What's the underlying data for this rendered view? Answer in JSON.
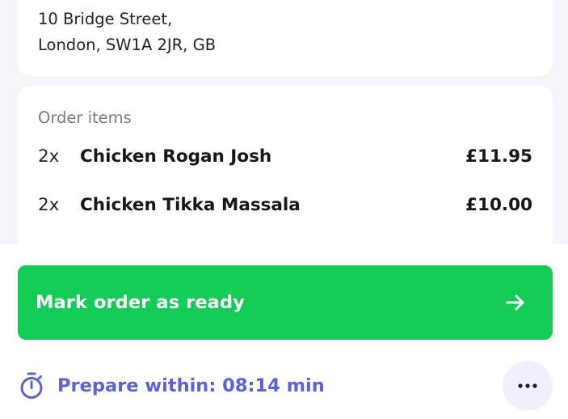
{
  "address": {
    "line1": "10 Bridge Street,",
    "line2": "London, SW1A 2JR, GB"
  },
  "order": {
    "label": "Order items",
    "items": [
      {
        "qty": "2x",
        "name": "Chicken Rogan Josh",
        "price": "£11.95"
      },
      {
        "qty": "2x",
        "name": "Chicken Tikka Massala",
        "price": "£10.00"
      },
      {
        "qty": "",
        "name": "",
        "price": ""
      }
    ]
  },
  "actions": {
    "mark_ready_label": "Mark order as ready",
    "arrow_icon": "arrow-right-icon",
    "more_icon": "ellipsis-horizontal-icon"
  },
  "timer": {
    "icon": "stopwatch-icon",
    "text": "Prepare within: 08:14 min"
  },
  "colors": {
    "accent_green": "#12cc56",
    "accent_indigo": "#5b63d8",
    "background": "#f3f5fb"
  }
}
